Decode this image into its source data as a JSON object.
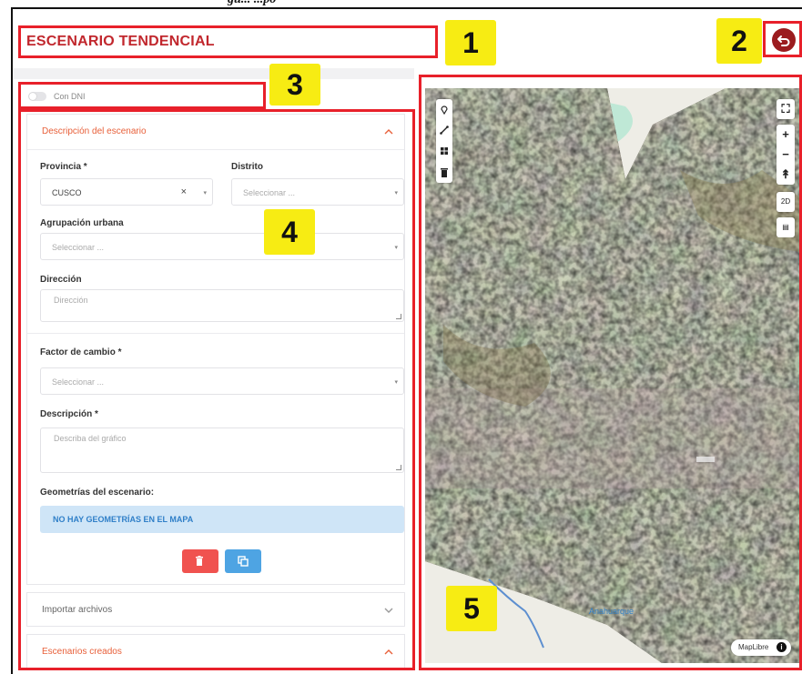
{
  "caption": "gu... ...po",
  "header": {
    "title": "ESCENARIO TENDENCIAL"
  },
  "badges": [
    "1",
    "2",
    "3",
    "4",
    "5"
  ],
  "toggle": {
    "label": "Con DNI"
  },
  "panel_description": {
    "title": "Descripción del escenario",
    "provincia_label": "Provincia *",
    "provincia_value": "CUSCO",
    "distrito_label": "Distrito",
    "distrito_placeholder": "Seleccionar ...",
    "agrupacion_label": "Agrupación urbana",
    "agrupacion_placeholder": "Seleccionar ...",
    "direccion_label": "Dirección",
    "direccion_placeholder": "Dirección",
    "factor_label": "Factor de cambio *",
    "factor_placeholder": "Seleccionar ...",
    "descripcion_label": "Descripción *",
    "descripcion_placeholder": "Describa del gráfico",
    "geometrias_label": "Geometrías del escenario:",
    "geometrias_alert": "NO HAY GEOMETRÍAS EN EL MAPA"
  },
  "panel_import": {
    "title": "Importar archivos"
  },
  "panel_created": {
    "title": "Escenarios creados"
  },
  "map": {
    "mode_button": "2D",
    "zoom_in": "+",
    "zoom_out": "−",
    "attribution": "MapLibre",
    "info": "i",
    "place_label": "Anahuarque"
  },
  "colors": {
    "accent_red": "#e8202a",
    "title_red": "#c1272d",
    "badge_yellow": "#f7ec13",
    "delete_button": "#f0524f",
    "copy_button": "#4ea4e3",
    "alert_bg": "#cfe5f7"
  }
}
